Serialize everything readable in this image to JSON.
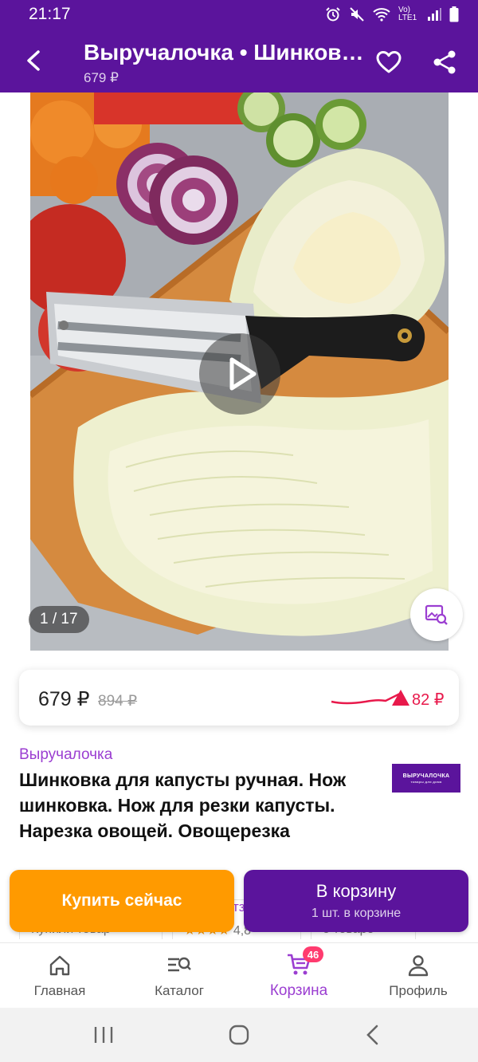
{
  "status_bar": {
    "time": "21:17",
    "network": "Vo) LTE1"
  },
  "app_bar": {
    "title": "Выручалочка • Шинков…",
    "price": "679 ₽"
  },
  "gallery": {
    "counter": "1 / 17"
  },
  "price_card": {
    "current": "679 ₽",
    "old": "894 ₽",
    "diff": "82 ₽",
    "diff_color": "#e8194b"
  },
  "product": {
    "seller": "Выручалочка",
    "title": "Шинковка для капусты ручная. Нож шинковка. Нож для резки капусты. Нарезка овощей. Овощерезка",
    "brand_logo_text": "ВЫРУЧАЛОЧКА",
    "brand_logo_sub": "товары для дома"
  },
  "peek_row": {
    "item1": "Купили товар",
    "item2": "4,8",
    "item3": "о товаре",
    "hidden_text": "тз"
  },
  "actions": {
    "buy_now": "Купить сейчас",
    "to_cart": "В корзину",
    "to_cart_sub": "1 шт. в корзине"
  },
  "bottom_nav": {
    "items": [
      {
        "label": "Главная",
        "icon": "home-icon"
      },
      {
        "label": "Каталог",
        "icon": "catalog-search-icon"
      },
      {
        "label": "Корзина",
        "icon": "cart-icon",
        "badge": "46"
      },
      {
        "label": "Профиль",
        "icon": "profile-icon"
      }
    ]
  },
  "colors": {
    "brand": "#5b149c",
    "accent": "#9b3ed1",
    "buy_now": "#ff9a00"
  }
}
